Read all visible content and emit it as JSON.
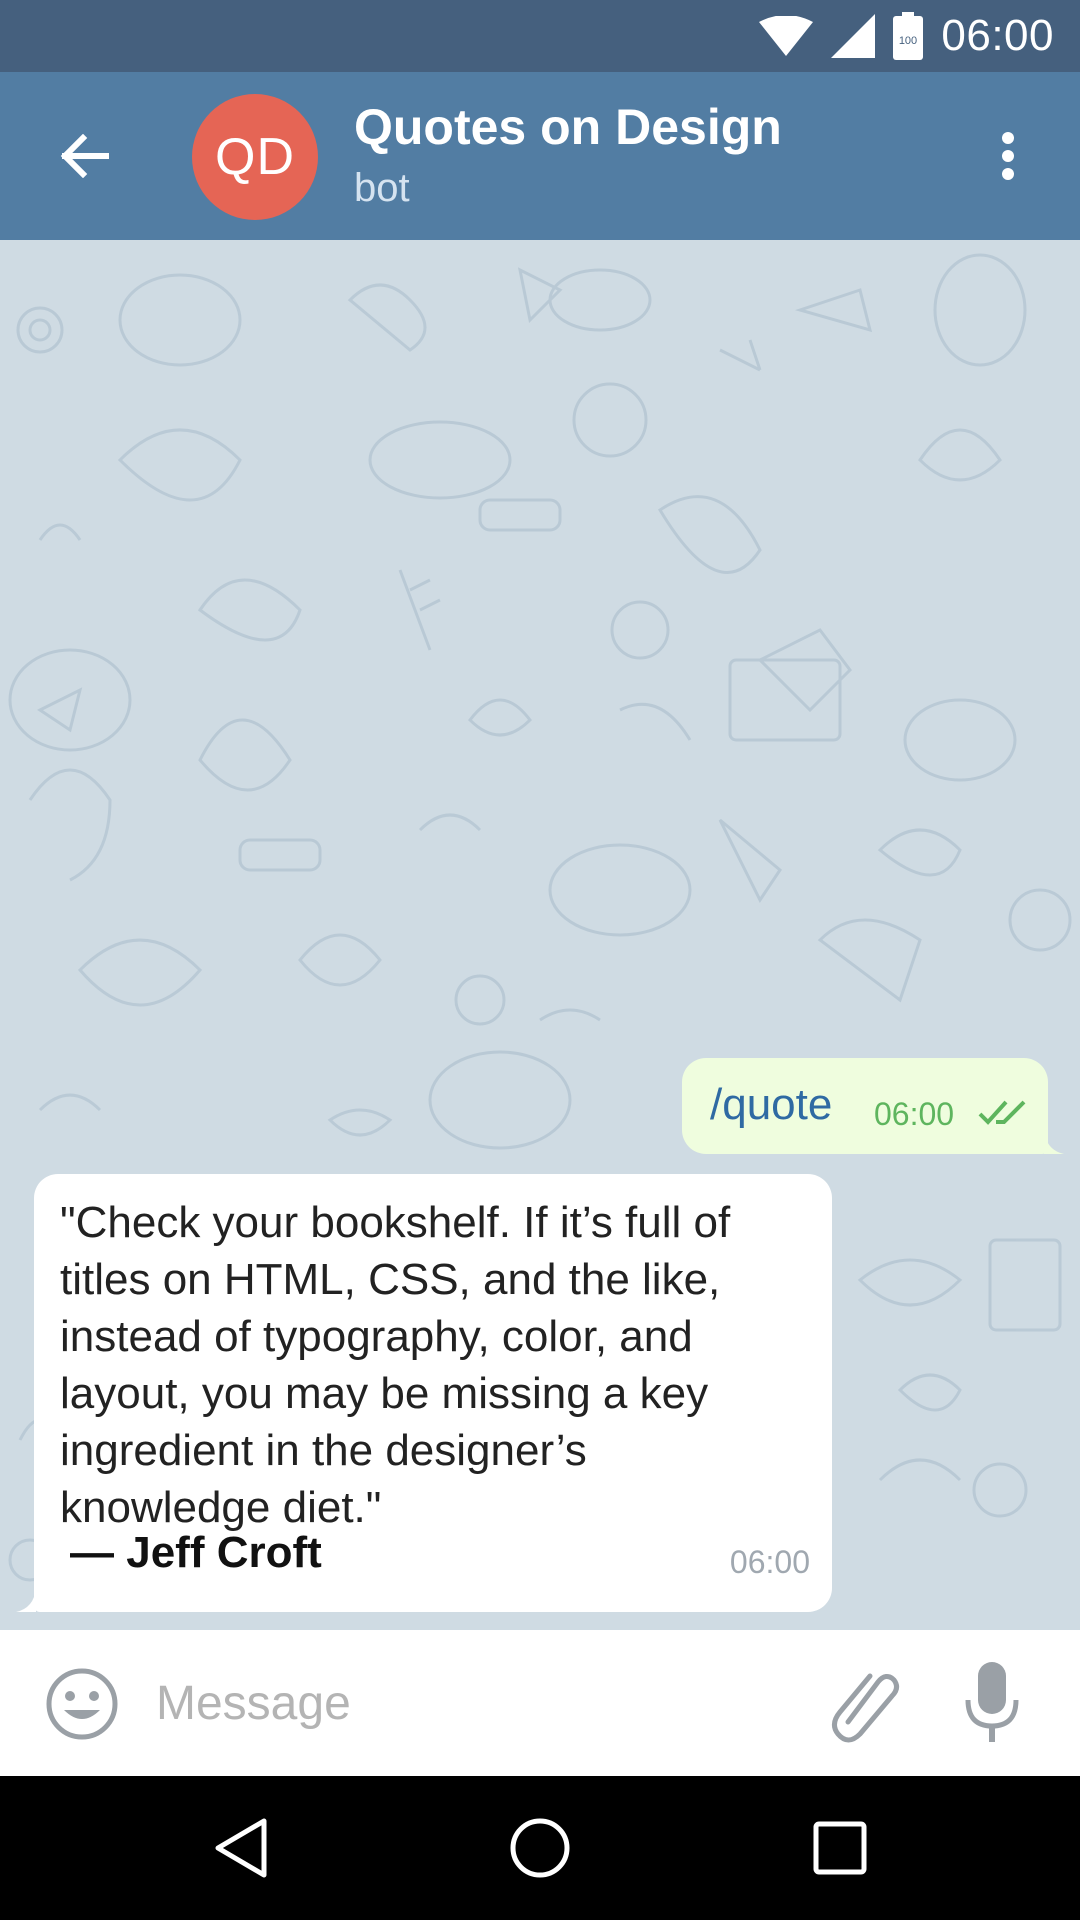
{
  "status_bar": {
    "time": "06:00",
    "battery_level": "100"
  },
  "header": {
    "avatar_initials": "QD",
    "avatar_color": "#e56555",
    "title": "Quotes on Design",
    "subtitle": "bot"
  },
  "messages": [
    {
      "direction": "outgoing",
      "text": "/quote",
      "time": "06:00",
      "status": "read"
    },
    {
      "direction": "incoming",
      "lines": [
        "\"Check your bookshelf. If it’s full of",
        "titles on HTML, CSS, and the like,",
        "instead of typography, color, and",
        "layout, you may be missing a key",
        "ingredient in the designer’s",
        "knowledge diet.\""
      ],
      "author": "— Jeff Croft",
      "time": "06:00"
    }
  ],
  "composer": {
    "placeholder": "Message",
    "value": ""
  },
  "icons": {
    "back": "arrow-left-icon",
    "menu": "more-vertical-icon",
    "emoji": "emoji-icon",
    "attach": "paperclip-icon",
    "mic": "mic-icon"
  },
  "colors": {
    "status_bar": "#45607e",
    "toolbar": "#527da3",
    "outgoing_bubble": "#effdde",
    "incoming_bubble": "#ffffff",
    "chat_background": "#cfdbe3"
  }
}
